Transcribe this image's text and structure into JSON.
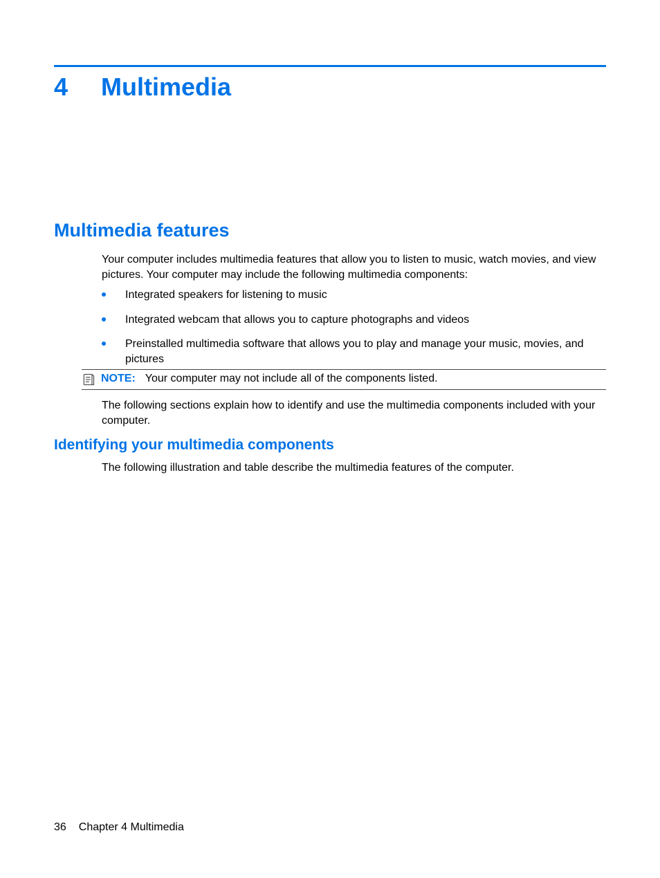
{
  "chapter": {
    "number": "4",
    "title": "Multimedia"
  },
  "section1": {
    "heading": "Multimedia features",
    "intro": "Your computer includes multimedia features that allow you to listen to music, watch movies, and view pictures. Your computer may include the following multimedia components:",
    "bullets": [
      "Integrated speakers for listening to music",
      "Integrated webcam that allows you to capture photographs and videos",
      "Preinstalled multimedia software that allows you to play and manage your music, movies, and pictures"
    ],
    "note_label": "NOTE:",
    "note_text": "Your computer may not include all of the components listed.",
    "after_note": "The following sections explain how to identify and use the multimedia components included with your computer."
  },
  "section2": {
    "heading": "Identifying your multimedia components",
    "body": "The following illustration and table describe the multimedia features of the computer."
  },
  "footer": {
    "page_number": "36",
    "chapter_label": "Chapter 4   Multimedia"
  }
}
